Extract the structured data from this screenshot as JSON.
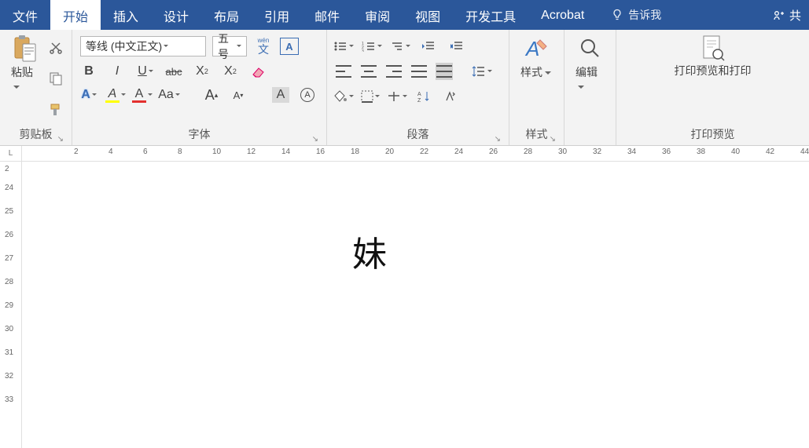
{
  "tabs": {
    "file": "文件",
    "home": "开始",
    "insert": "插入",
    "design": "设计",
    "layout": "布局",
    "references": "引用",
    "mail": "邮件",
    "review": "审阅",
    "view": "视图",
    "developer": "开发工具",
    "acrobat": "Acrobat"
  },
  "tell_me": "告诉我",
  "share": "共",
  "groups": {
    "clipboard": {
      "label": "剪贴板",
      "paste": "粘贴"
    },
    "font": {
      "label": "字体",
      "name": "等线 (中文正文)",
      "size": "五号",
      "wen": "wén",
      "zi": "文",
      "charbox": "A",
      "bold": "B",
      "italic": "I",
      "underline": "U",
      "strike": "abc",
      "sub": "X",
      "sub2": "2",
      "sup": "X",
      "sup2": "2",
      "texteffect": "A",
      "highlight": "A",
      "fontcolor": "A",
      "aa": "Aa",
      "grow": "A",
      "shrink": "A",
      "clear": "A",
      "charshade": "A"
    },
    "paragraph": {
      "label": "段落"
    },
    "styles": {
      "label": "样式",
      "btn": "样式"
    },
    "editing": {
      "btn": "编辑"
    },
    "print": {
      "label": "打印预览",
      "btn": "打印预览和打印"
    }
  },
  "ruler_h": [
    2,
    4,
    6,
    8,
    10,
    12,
    14,
    16,
    18,
    20,
    22,
    24,
    26,
    28,
    30,
    32,
    34,
    36,
    38,
    40,
    42,
    44
  ],
  "ruler_v": [
    2,
    24,
    25,
    26,
    27,
    28,
    29,
    30,
    31,
    32,
    33
  ],
  "document": {
    "text": "妹"
  }
}
